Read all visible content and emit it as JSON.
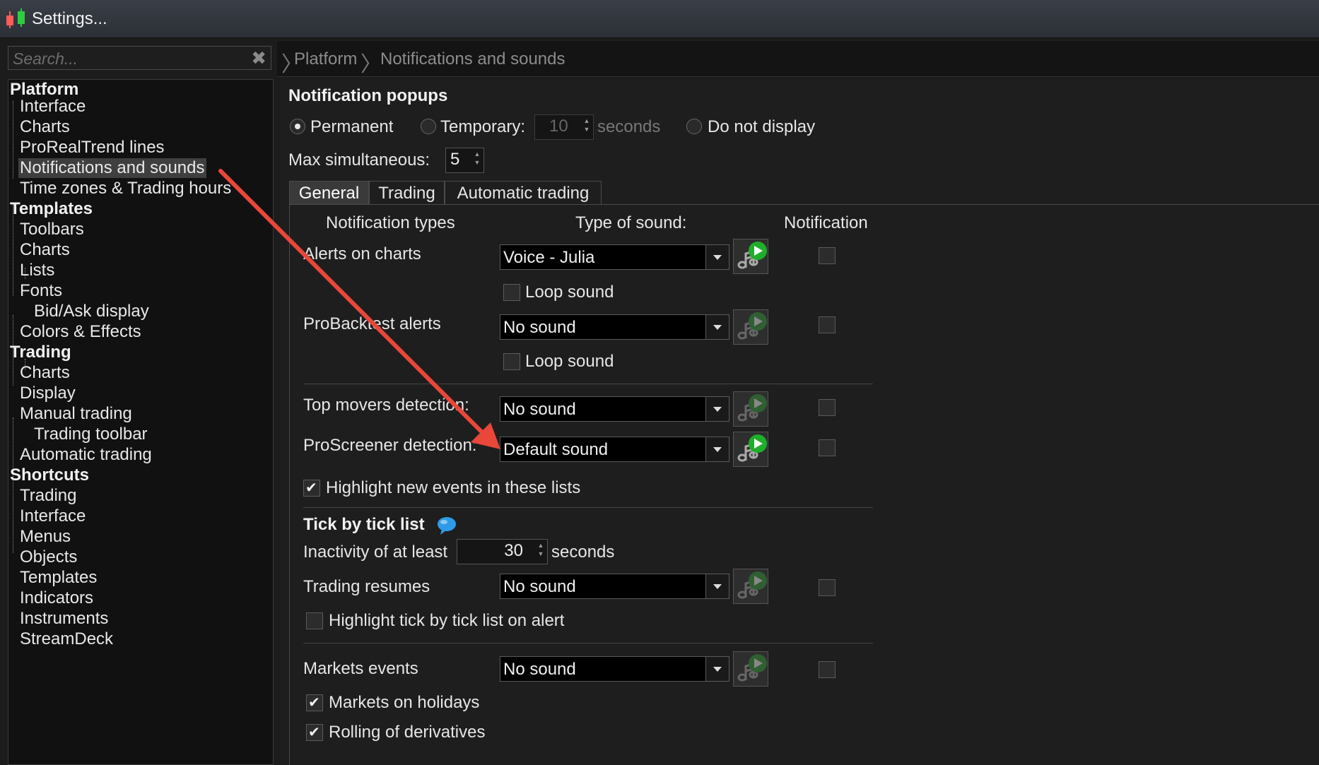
{
  "window": {
    "title": "Settings..."
  },
  "search": {
    "placeholder": "Search..."
  },
  "breadcrumb": {
    "items": [
      "Platform",
      "Notifications and sounds"
    ]
  },
  "sidebar": {
    "categories": [
      {
        "label": "Platform",
        "items": [
          "Interface",
          "Charts",
          "ProRealTrend lines",
          "Notifications and sounds",
          "Time zones & Trading hours"
        ]
      },
      {
        "label": "Templates",
        "items": [
          "Toolbars",
          "Charts",
          "Lists",
          "Fonts",
          "Bid/Ask display",
          "Colors & Effects"
        ]
      },
      {
        "label": "Trading",
        "items": [
          "Charts",
          "Display",
          "Manual trading",
          "Trading toolbar",
          "Automatic trading"
        ]
      },
      {
        "label": "Shortcuts",
        "items": [
          "Trading",
          "Interface",
          "Menus",
          "Objects",
          "Templates",
          "Indicators",
          "Instruments",
          "StreamDeck"
        ]
      }
    ],
    "selected": "Notifications and sounds"
  },
  "popups": {
    "title": "Notification popups",
    "permanent_label": "Permanent",
    "temporary_label": "Temporary:",
    "temporary_value": "10",
    "seconds_label": "seconds",
    "donotdisplay_label": "Do not display",
    "selected": "Permanent",
    "max_label": "Max simultaneous:",
    "max_value": "5"
  },
  "tabs": [
    "General",
    "Trading",
    "Automatic trading"
  ],
  "active_tab": "General",
  "table": {
    "col_types": "Notification types",
    "col_sound": "Type of sound:",
    "col_notification": "Notification"
  },
  "rows": {
    "alerts_charts": {
      "label": "Alerts on charts",
      "sound": "Voice - Julia",
      "loop_label": "Loop sound",
      "loop": false,
      "notify": false
    },
    "probacktest": {
      "label": "ProBacktest alerts",
      "sound": "No sound",
      "loop_label": "Loop sound",
      "loop": false,
      "notify": false
    },
    "top_movers": {
      "label": "Top movers detection:",
      "sound": "No sound",
      "notify": false
    },
    "proscreener": {
      "label": "ProScreener detection:",
      "sound": "Default sound",
      "notify": false
    },
    "highlight_lists": {
      "label": "Highlight new events in these lists",
      "checked": true
    }
  },
  "tick": {
    "title": "Tick by tick list",
    "inactivity_label": "Inactivity of at least",
    "inactivity_value": "30",
    "seconds_label": "seconds",
    "resumes_label": "Trading resumes",
    "resumes_sound": "No sound",
    "highlight_label": "Highlight tick by tick list on alert",
    "highlight_checked": false
  },
  "markets": {
    "label": "Markets events",
    "sound": "No sound",
    "holidays_label": "Markets on holidays",
    "holidays_checked": true,
    "rolling_label": "Rolling of derivatives",
    "rolling_checked": true
  },
  "icons": [
    "app-candlestick-icon",
    "clear-icon",
    "play-sound-icon",
    "info-bubble-icon",
    "chevron-right-icon"
  ],
  "colors": {
    "accent_arrow": "#e8473a",
    "play_green": "#1fae2a",
    "selected_bg": "#3f3f3f"
  }
}
